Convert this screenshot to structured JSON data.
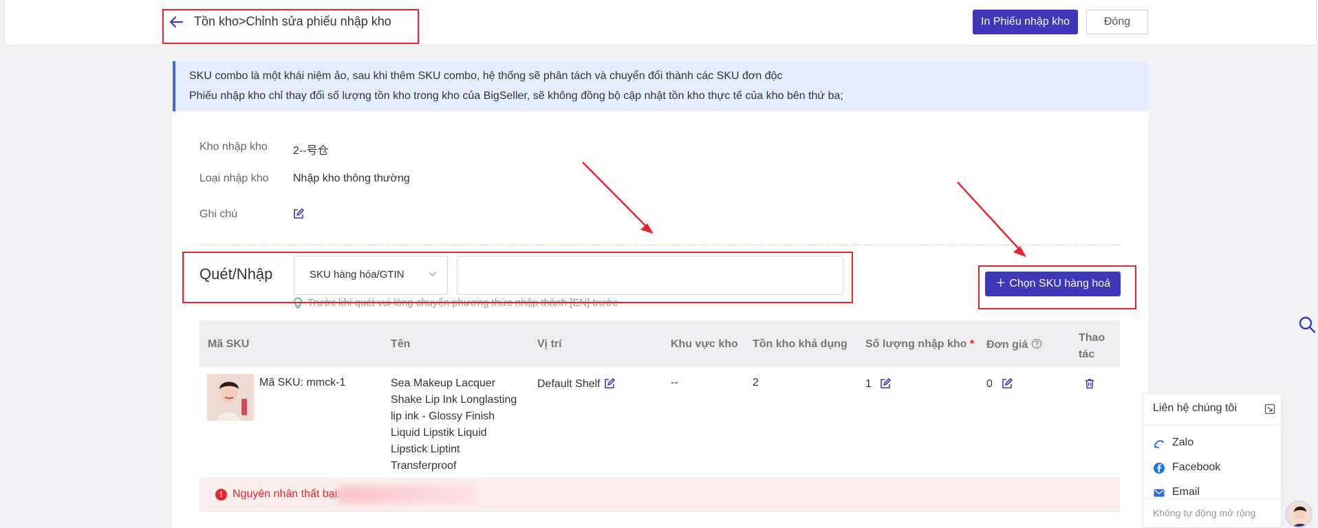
{
  "header": {
    "breadcrumb": "Tồn kho>Chỉnh sửa phiếu nhập kho",
    "print_button": "In Phiếu nhập kho",
    "close_button": "Đóng"
  },
  "notice": {
    "line1": "SKU combo là một khái niệm ảo, sau khi thêm SKU combo, hệ thống sẽ phân tách và chuyển đổi thành các SKU đơn độc",
    "line2": "Phiếu nhập kho chỉ thay đổi số lượng tồn kho trong kho của BigSeller, sẽ không đồng bộ cập nhật tồn kho thực tế của kho bên thứ ba;"
  },
  "form": {
    "warehouse_label": "Kho nhập kho",
    "warehouse_value": "2--号仓",
    "type_label": "Loại nhập kho",
    "type_value": "Nhập kho thông thường",
    "note_label": "Ghi chú"
  },
  "scan": {
    "title": "Quét/Nhập",
    "select_value": "SKU hàng hóa/GTIN",
    "input_value": "",
    "hint": "Trước khi quét vui lòng chuyển phương thức nhập thành [EN] trước",
    "choose_sku_button": "Chọn SKU hàng hoá"
  },
  "table": {
    "headers": [
      "Mã SKU",
      "Tên",
      "Vị trí",
      "Khu vực kho",
      "Tồn kho khả dụng",
      "Số lượng nhập kho",
      "Đơn giá",
      "Thao tác"
    ],
    "required_mark": "*",
    "rows": [
      {
        "sku": "Mã SKU: mmck-1",
        "name": "Sea Makeup Lacquer Shake Lip Ink Longlasting lip ink - Glossy Finish Liquid Lipstik Liquid Lipstick Liptint Transferproof",
        "location": "Default Shelf",
        "zone": "--",
        "available": "2",
        "quantity": "1",
        "price": "0"
      }
    ],
    "error": "Nguyên nhân thất bại:"
  },
  "contact": {
    "title": "Liên hệ chúng tôi",
    "items": [
      "Zalo",
      "Facebook",
      "Email"
    ],
    "footer": "Không tự động mở rộng"
  },
  "colors": {
    "primary": "#3f36b8",
    "annotation": "#e8252f",
    "notice_bg": "#e3edfb"
  }
}
